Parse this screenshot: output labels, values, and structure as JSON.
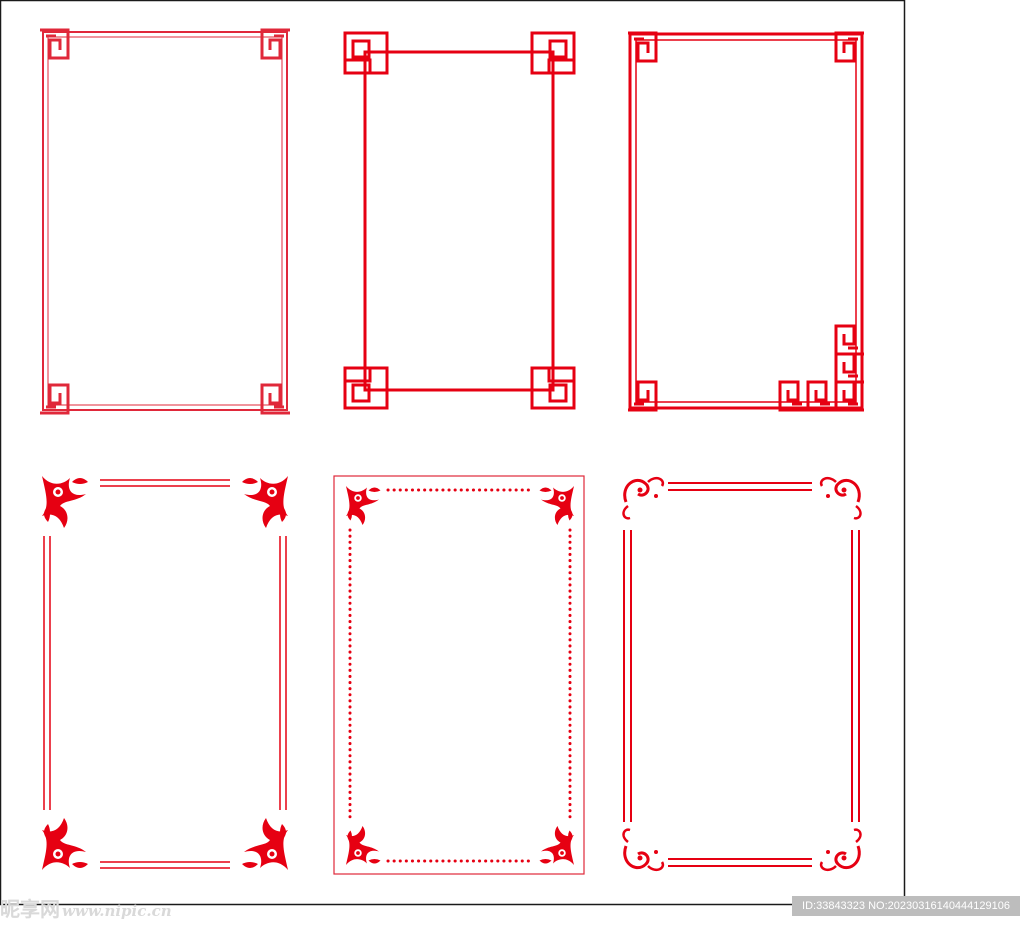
{
  "colors": {
    "frame_red": "#e60012",
    "frame_crimson": "#e0283a",
    "border": "#1a1a1a",
    "watermark": "#d9d9d9",
    "id_badge": "#bdbdbd"
  },
  "frames": [
    {
      "style": "chinese-fret-thin-corners"
    },
    {
      "style": "chinese-fret-bold-corners"
    },
    {
      "style": "chinese-fret-asymmetric-corners"
    },
    {
      "style": "floral-corners-double-line"
    },
    {
      "style": "floral-corners-dotted-line"
    },
    {
      "style": "scroll-corners-split-lines"
    }
  ],
  "watermark": {
    "brand": "昵享网",
    "site": "www.nipic.cn",
    "id_text": "ID:33843323 NO:20230316140444129106"
  }
}
